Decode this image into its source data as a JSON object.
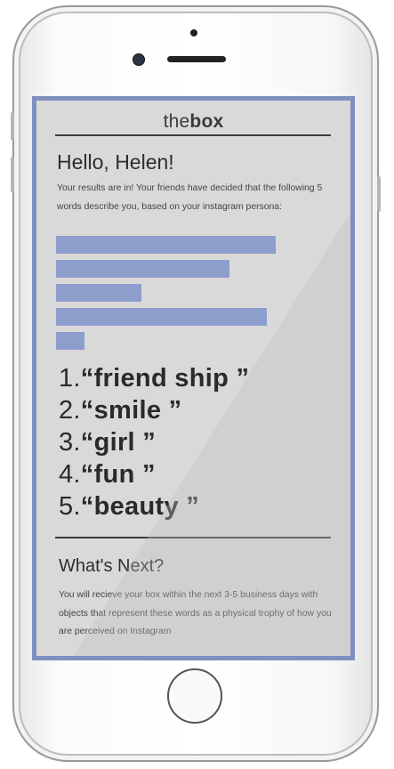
{
  "app": {
    "brand_light": "the",
    "brand_bold": "box"
  },
  "results": {
    "greeting": "Hello, Helen!",
    "intro": "Your results are in! Your friends have decided that the following 5 words describe you, based on your instagram persona:",
    "bars": [
      {
        "value": 1.0
      },
      {
        "value": 0.79
      },
      {
        "value": 0.39
      },
      {
        "value": 0.96
      },
      {
        "value": 0.13
      }
    ],
    "bar_color": "#8d9dcc",
    "words": [
      {
        "num": "1.",
        "text": "“friend ship ”"
      },
      {
        "num": "2.",
        "text": "“smile ”"
      },
      {
        "num": "3.",
        "text": "“girl ”"
      },
      {
        "num": "4.",
        "text": "“fun ”"
      },
      {
        "num": "5.",
        "text": "“beauty ”"
      }
    ]
  },
  "next": {
    "title": "What's Next?",
    "body": "You will recieve your box within the next 3-5 business days with objects that represent these words as a physical trophy of how you are perceived on Instagram"
  },
  "colors": {
    "screen_border": "#7f8fbf",
    "screen_background": "#d9d9d9"
  }
}
